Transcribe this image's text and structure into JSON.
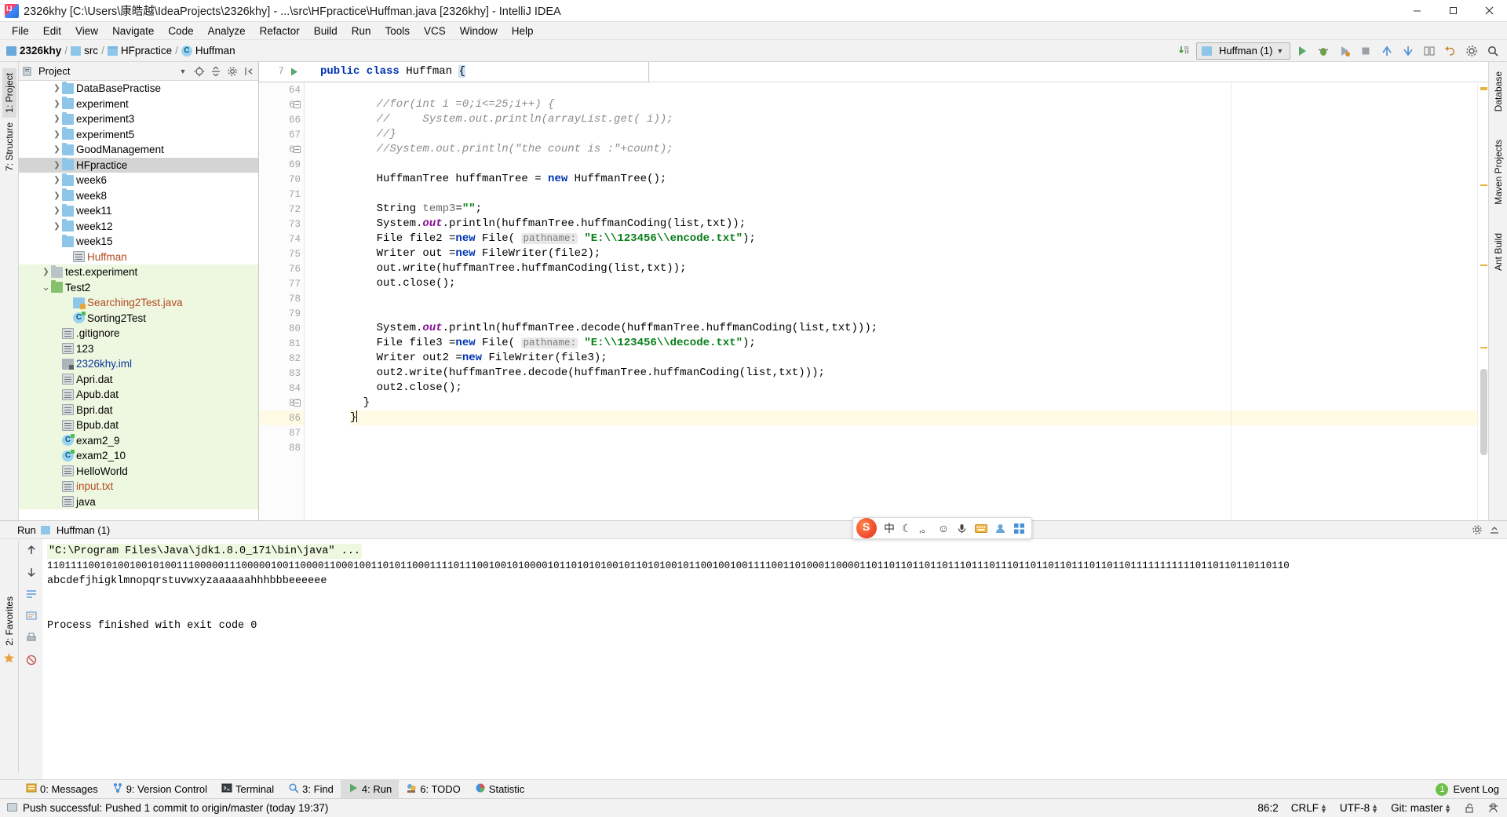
{
  "window": {
    "title": "2326khy [C:\\Users\\康皓越\\IdeaProjects\\2326khy] - ...\\src\\HFpractice\\Huffman.java [2326khy] - IntelliJ IDEA",
    "minimize": "–",
    "maximize": "□",
    "close": "✕"
  },
  "menu": [
    {
      "label": "File"
    },
    {
      "label": "Edit"
    },
    {
      "label": "View"
    },
    {
      "label": "Navigate"
    },
    {
      "label": "Code"
    },
    {
      "label": "Analyze"
    },
    {
      "label": "Refactor"
    },
    {
      "label": "Build"
    },
    {
      "label": "Run"
    },
    {
      "label": "Tools"
    },
    {
      "label": "VCS"
    },
    {
      "label": "Window"
    },
    {
      "label": "Help"
    }
  ],
  "breadcrumb": [
    {
      "label": "2326khy",
      "icon": "module-icon"
    },
    {
      "label": "src",
      "icon": "source-folder-icon"
    },
    {
      "label": "HFpractice",
      "icon": "folder-icon"
    },
    {
      "label": "Huffman",
      "icon": "class-icon"
    }
  ],
  "toolbar": {
    "run_config": "Huffman (1)",
    "run_button": "▶",
    "debug_button": "🐞",
    "coverage_button": "▶",
    "stop_button": "■",
    "search_button": "🔍",
    "settings_button": "⚙",
    "updates_icon": "download-updates-icon"
  },
  "left_tool_tabs": [
    {
      "label": "1: Project",
      "active": true
    },
    {
      "label": "7: Structure",
      "active": false
    }
  ],
  "right_tool_tabs": [
    {
      "label": "Database"
    },
    {
      "label": "Maven Projects"
    },
    {
      "label": "Ant Build"
    }
  ],
  "project_panel": {
    "title": "Project",
    "dropdown_icon": "chevron-down-icon",
    "locate_icon": "target-icon",
    "collapse_icon": "collapse-all-icon",
    "settings_icon": "gear-icon",
    "hide_icon": "hide-icon",
    "tree": [
      {
        "label": "DataBasePractise",
        "type": "folder",
        "indent": 3,
        "arrow": "›",
        "selected": false,
        "vcs": false
      },
      {
        "label": "experiment",
        "type": "folder",
        "indent": 3,
        "arrow": "›",
        "selected": false,
        "vcs": false
      },
      {
        "label": "experiment3",
        "type": "folder",
        "indent": 3,
        "arrow": "›",
        "selected": false,
        "vcs": false
      },
      {
        "label": "experiment5",
        "type": "folder",
        "indent": 3,
        "arrow": "›",
        "selected": false,
        "vcs": false
      },
      {
        "label": "GoodManagement",
        "type": "folder",
        "indent": 3,
        "arrow": "›",
        "selected": false,
        "vcs": false
      },
      {
        "label": "HFpractice",
        "type": "folder",
        "indent": 3,
        "arrow": "›",
        "selected": true,
        "vcs": false
      },
      {
        "label": "week6",
        "type": "folder",
        "indent": 3,
        "arrow": "›",
        "selected": false,
        "vcs": false
      },
      {
        "label": "week8",
        "type": "folder",
        "indent": 3,
        "arrow": "›",
        "selected": false,
        "vcs": false
      },
      {
        "label": "week11",
        "type": "folder",
        "indent": 3,
        "arrow": "›",
        "selected": false,
        "vcs": false
      },
      {
        "label": "week12",
        "type": "folder",
        "indent": 3,
        "arrow": "›",
        "selected": false,
        "vcs": false
      },
      {
        "label": "week15",
        "type": "folder",
        "indent": 3,
        "arrow": "",
        "selected": false,
        "vcs": false
      },
      {
        "label": "Huffman",
        "type": "file",
        "indent": 4,
        "arrow": "",
        "selected": false,
        "vcs": false,
        "color": "unversioned"
      },
      {
        "label": "test.experiment",
        "type": "folder-grey",
        "indent": 2,
        "arrow": "›",
        "selected": false,
        "vcs": true
      },
      {
        "label": "Test2",
        "type": "folder-green",
        "indent": 2,
        "arrow": "⌄",
        "selected": false,
        "vcs": true
      },
      {
        "label": "Searching2Test.java",
        "type": "java",
        "indent": 4,
        "arrow": "",
        "selected": false,
        "vcs": true,
        "color": "unversioned"
      },
      {
        "label": "Sorting2Test",
        "type": "class",
        "indent": 4,
        "arrow": "",
        "selected": false,
        "vcs": true
      },
      {
        "label": ".gitignore",
        "type": "file",
        "indent": 3,
        "arrow": "",
        "selected": false,
        "vcs": true
      },
      {
        "label": "123",
        "type": "file",
        "indent": 3,
        "arrow": "",
        "selected": false,
        "vcs": true
      },
      {
        "label": "2326khy.iml",
        "type": "iml",
        "indent": 3,
        "arrow": "",
        "selected": false,
        "vcs": true,
        "color": "modified"
      },
      {
        "label": "Apri.dat",
        "type": "file",
        "indent": 3,
        "arrow": "",
        "selected": false,
        "vcs": true
      },
      {
        "label": "Apub.dat",
        "type": "file",
        "indent": 3,
        "arrow": "",
        "selected": false,
        "vcs": true
      },
      {
        "label": "Bpri.dat",
        "type": "file",
        "indent": 3,
        "arrow": "",
        "selected": false,
        "vcs": true
      },
      {
        "label": "Bpub.dat",
        "type": "file",
        "indent": 3,
        "arrow": "",
        "selected": false,
        "vcs": true
      },
      {
        "label": "exam2_9",
        "type": "class",
        "indent": 3,
        "arrow": "",
        "selected": false,
        "vcs": true
      },
      {
        "label": "exam2_10",
        "type": "class",
        "indent": 3,
        "arrow": "",
        "selected": false,
        "vcs": true
      },
      {
        "label": "HelloWorld",
        "type": "file",
        "indent": 3,
        "arrow": "",
        "selected": false,
        "vcs": true
      },
      {
        "label": "input.txt",
        "type": "file",
        "indent": 3,
        "arrow": "",
        "selected": false,
        "vcs": true,
        "color": "unversioned"
      },
      {
        "label": "java",
        "type": "file",
        "indent": 3,
        "arrow": "",
        "selected": false,
        "vcs": true
      }
    ]
  },
  "editor": {
    "sticky_line_number": "7",
    "sticky_run_icon": "run-gutter-icon",
    "sticky_code_pre": "public class",
    "sticky_code_name": " Huffman ",
    "sticky_code_brace": "{",
    "first_line_number": 64,
    "current_line": 86,
    "lines": [
      {
        "n": 64,
        "segs": []
      },
      {
        "n": 65,
        "fold": true,
        "segs": [
          {
            "t": "    //for(int i =0;i<=25;i++) {",
            "c": "cmt"
          }
        ]
      },
      {
        "n": 66,
        "segs": [
          {
            "t": "    //     System.out.println(arrayList.get( i));",
            "c": "cmt"
          }
        ]
      },
      {
        "n": 67,
        "segs": [
          {
            "t": "    //}",
            "c": "cmt"
          }
        ]
      },
      {
        "n": 68,
        "fold": true,
        "segs": [
          {
            "t": "    //System.out.println(\"the count is :\"+count);",
            "c": "cmt"
          }
        ]
      },
      {
        "n": 69,
        "segs": []
      },
      {
        "n": 70,
        "segs": [
          {
            "t": "    HuffmanTree huffmanTree = ",
            "c": ""
          },
          {
            "t": "new",
            "c": "kw"
          },
          {
            "t": " HuffmanTree();",
            "c": ""
          }
        ]
      },
      {
        "n": 71,
        "segs": []
      },
      {
        "n": 72,
        "segs": [
          {
            "t": "    String ",
            "c": ""
          },
          {
            "t": "temp3",
            "c": "ident-grey"
          },
          {
            "t": "=",
            "c": ""
          },
          {
            "t": "\"\"",
            "c": "str"
          },
          {
            "t": ";",
            "c": ""
          }
        ]
      },
      {
        "n": 73,
        "segs": [
          {
            "t": "    System.",
            "c": ""
          },
          {
            "t": "out",
            "c": "field"
          },
          {
            "t": ".println(huffmanTree.huffmanCoding(list,txt));",
            "c": ""
          }
        ]
      },
      {
        "n": 74,
        "segs": [
          {
            "t": "    File file2 =",
            "c": ""
          },
          {
            "t": "new",
            "c": "kw"
          },
          {
            "t": " File( ",
            "c": ""
          },
          {
            "t": "pathname:",
            "c": "hint"
          },
          {
            "t": " ",
            "c": ""
          },
          {
            "t": "\"E:\\\\123456\\\\encode.txt\"",
            "c": "str"
          },
          {
            "t": ");",
            "c": ""
          }
        ]
      },
      {
        "n": 75,
        "segs": [
          {
            "t": "    Writer out =",
            "c": ""
          },
          {
            "t": "new",
            "c": "kw"
          },
          {
            "t": " FileWriter(file2);",
            "c": ""
          }
        ]
      },
      {
        "n": 76,
        "segs": [
          {
            "t": "    out.write(huffmanTree.huffmanCoding(list,txt));",
            "c": ""
          }
        ]
      },
      {
        "n": 77,
        "segs": [
          {
            "t": "    out.close();",
            "c": ""
          }
        ]
      },
      {
        "n": 78,
        "segs": []
      },
      {
        "n": 79,
        "segs": []
      },
      {
        "n": 80,
        "segs": [
          {
            "t": "    System.",
            "c": ""
          },
          {
            "t": "out",
            "c": "field"
          },
          {
            "t": ".println(huffmanTree.decode(huffmanTree.huffmanCoding(list,txt)));",
            "c": ""
          }
        ]
      },
      {
        "n": 81,
        "segs": [
          {
            "t": "    File file3 =",
            "c": ""
          },
          {
            "t": "new",
            "c": "kw"
          },
          {
            "t": " File( ",
            "c": ""
          },
          {
            "t": "pathname:",
            "c": "hint"
          },
          {
            "t": " ",
            "c": ""
          },
          {
            "t": "\"E:\\\\123456\\\\decode.txt\"",
            "c": "str"
          },
          {
            "t": ");",
            "c": ""
          }
        ]
      },
      {
        "n": 82,
        "segs": [
          {
            "t": "    Writer out2 =",
            "c": ""
          },
          {
            "t": "new",
            "c": "kw"
          },
          {
            "t": " FileWriter(file3);",
            "c": ""
          }
        ]
      },
      {
        "n": 83,
        "segs": [
          {
            "t": "    out2.write(huffmanTree.decode(huffmanTree.huffmanCoding(list,txt)));",
            "c": ""
          }
        ]
      },
      {
        "n": 84,
        "segs": [
          {
            "t": "    out2.close();",
            "c": ""
          }
        ]
      },
      {
        "n": 85,
        "fold": true,
        "segs": [
          {
            "t": "  }",
            "c": ""
          }
        ]
      },
      {
        "n": 86,
        "current": true,
        "segs": [
          {
            "t": "}",
            "c": ""
          }
        ]
      },
      {
        "n": 87,
        "segs": []
      },
      {
        "n": 88,
        "segs": []
      }
    ]
  },
  "run_window": {
    "tab_label": "Run",
    "config_label": "Huffman (1)",
    "rerun_icon": "run-icon",
    "stop_icon": "stop-icon",
    "pause_icon": "pause-icon",
    "up_icon": "arrow-up-icon",
    "down_icon": "arrow-down-icon",
    "settings_icon": "gear-icon",
    "hide_icon": "hide-icon",
    "console": {
      "command": "\"C:\\Program Files\\Java\\jdk1.8.0_171\\bin\\java\" ...",
      "binary_output": "1101111001010010010100111000001110000010011000011000100110101100011110111001001010000101101010100101101010010110010010011110011010001100001101101101101101110111011101101101101110110110111111111110110110110110110",
      "decoded_output": "abcdefjhigklmnopqrstuvwxyzaaaaaahhhbbbeeeeee",
      "exit_message": "Process finished with exit code 0"
    }
  },
  "ime": {
    "logo": "sogou-logo-icon",
    "mode": "中",
    "moon_icon": "moon-icon",
    "punct_icon": "punctuation-icon",
    "emoji_icon": "emoji-icon",
    "mic_icon": "microphone-icon",
    "keyboard_icon": "keyboard-icon",
    "user_icon": "user-icon",
    "menu_icon": "grid-menu-icon"
  },
  "bottom_tabs": [
    {
      "label": "0: Messages",
      "num": "0",
      "icon": "messages-icon",
      "active": false
    },
    {
      "label": "9: Version Control",
      "num": "9",
      "icon": "version-control-icon",
      "active": false
    },
    {
      "label": "Terminal",
      "num": "",
      "icon": "terminal-icon",
      "active": false
    },
    {
      "label": "3: Find",
      "num": "3",
      "icon": "find-icon",
      "active": false
    },
    {
      "label": "4: Run",
      "num": "4",
      "icon": "run-icon",
      "active": true
    },
    {
      "label": "6: TODO",
      "num": "6",
      "icon": "todo-icon",
      "active": false
    },
    {
      "label": "Statistic",
      "num": "",
      "icon": "statistic-icon",
      "active": false
    }
  ],
  "event_log": {
    "count": "1",
    "label": "Event Log"
  },
  "statusbar": {
    "message": "Push successful: Pushed 1 commit to origin/master (today 19:37)",
    "message_icon": "notification-icon",
    "caret_position": "86:2",
    "line_separator": "CRLF",
    "encoding": "UTF-8",
    "branch": "Git: master",
    "lock_icon": "unlocked-icon",
    "inspector_icon": "inspector-icon"
  },
  "colors": {
    "accent_green": "#067d17",
    "keyword_blue": "#0033b3",
    "vcs_green_bg": "#eef7e0",
    "selection_grey": "#d4d4d4",
    "current_line": "#fffae3"
  }
}
